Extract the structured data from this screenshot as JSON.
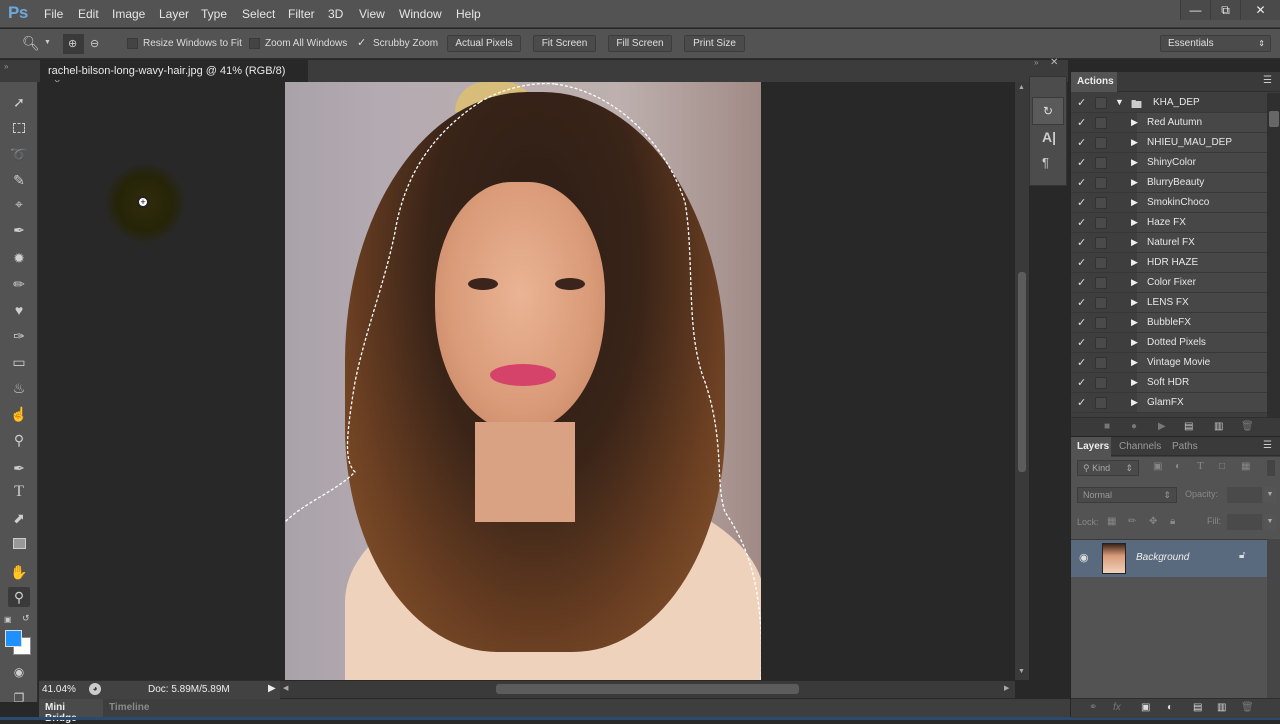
{
  "app": {
    "logo": "Ps"
  },
  "menu": [
    "File",
    "Edit",
    "Image",
    "Layer",
    "Type",
    "Select",
    "Filter",
    "3D",
    "View",
    "Window",
    "Help"
  ],
  "window_controls": {
    "minimize": "—",
    "restore": "⧉",
    "close": "✕"
  },
  "options": {
    "resize_windows": "Resize Windows to Fit",
    "zoom_all": "Zoom All Windows",
    "scrubby_zoom": "Scrubby Zoom",
    "actual_pixels": "Actual Pixels",
    "fit_screen": "Fit Screen",
    "fill_screen": "Fill Screen",
    "print_size": "Print Size",
    "workspace": "Essentials",
    "resize_checked": false,
    "zoom_all_checked": false,
    "scrubby_checked": true
  },
  "document": {
    "tab_title": "rachel-bilson-long-wavy-hair.jpg @ 41% (RGB/8)",
    "close": "×"
  },
  "status": {
    "zoom": "41.04%",
    "doc": "Doc: 5.89M/5.89M"
  },
  "bottom_tabs": [
    "Mini Bridge",
    "Timeline"
  ],
  "actions_panel": {
    "title": "Actions",
    "set_name": "KHA_DEP",
    "items": [
      "Red Autumn",
      "NHIEU_MAU_DEP",
      "ShinyColor",
      "BlurryBeauty",
      "SmokinChoco",
      "Haze FX",
      "Naturel FX",
      "HDR HAZE",
      "Color Fixer",
      "LENS FX",
      "BubbleFX",
      "Dotted Pixels",
      "Vintage Movie",
      "Soft HDR",
      "GlamFX"
    ]
  },
  "layers_panel": {
    "tabs": [
      "Layers",
      "Channels",
      "Paths"
    ],
    "filter_kind": "Kind",
    "blend_mode": "Normal",
    "opacity_label": "Opacity:",
    "lock_label": "Lock:",
    "fill_label": "Fill:",
    "layers": [
      {
        "name": "Background",
        "visible": true,
        "locked": true
      }
    ]
  },
  "colors": {
    "foreground": "#1e90ff",
    "background": "#ffffff",
    "selected_layer": "#5a6a7e"
  }
}
